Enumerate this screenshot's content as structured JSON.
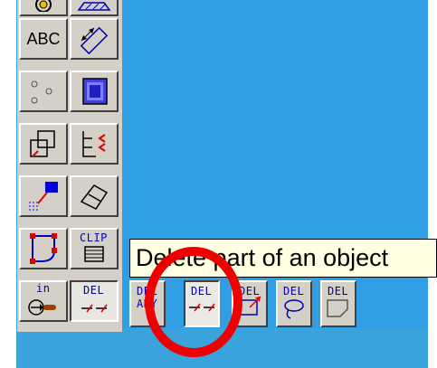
{
  "toolbar": {
    "abc_label": "ABC",
    "clip_label": "CLIP",
    "in_label": "in",
    "del_label": "DEL"
  },
  "flyout": {
    "del_any": {
      "line1": "DEL",
      "line2": "ANY"
    },
    "del_part": "DEL",
    "del_window": "DEL",
    "del_lasso": "DEL",
    "del_shape": "DEL"
  },
  "tooltip": {
    "text": "Delete part of an object"
  },
  "colors": {
    "workspace": "#2f9ee2",
    "button_face": "#d4d0c8",
    "tooltip_bg": "#ffffe1",
    "highlight_circle": "#ee0000",
    "icon_blue": "#0000b0"
  }
}
